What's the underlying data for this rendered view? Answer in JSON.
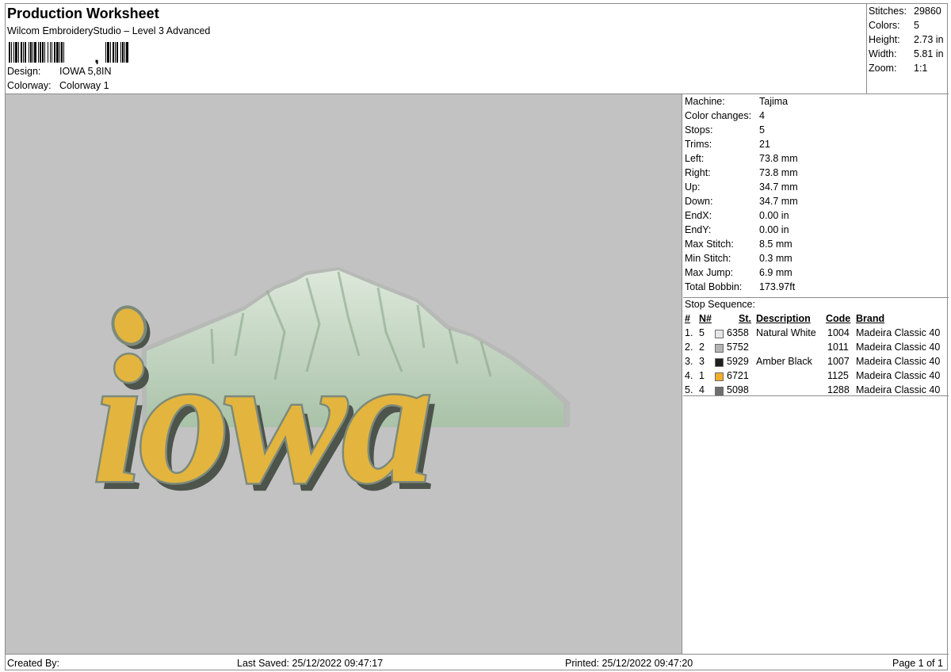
{
  "header": {
    "title": "Production Worksheet",
    "subtitle": "Wilcom EmbroideryStudio – Level 3 Advanced",
    "barcode_suffix": ",",
    "design_label": "Design:",
    "design_value": "IOWA 5,8IN",
    "colorway_label": "Colorway:",
    "colorway_value": "Colorway 1"
  },
  "stats": [
    {
      "label": "Stitches:",
      "value": "29860"
    },
    {
      "label": "Colors:",
      "value": "5"
    },
    {
      "label": "Height:",
      "value": "2.73 in"
    },
    {
      "label": "Width:",
      "value": "5.81 in"
    },
    {
      "label": "Zoom:",
      "value": "1:1"
    }
  ],
  "info": [
    {
      "label": "Machine:",
      "value": "Tajima"
    },
    {
      "label": "Color changes:",
      "value": "4"
    },
    {
      "label": "Stops:",
      "value": "5"
    },
    {
      "label": "Trims:",
      "value": "21"
    },
    {
      "label": "Left:",
      "value": "73.8 mm"
    },
    {
      "label": "Right:",
      "value": "73.8 mm"
    },
    {
      "label": "Up:",
      "value": "34.7 mm"
    },
    {
      "label": "Down:",
      "value": "34.7 mm"
    },
    {
      "label": "EndX:",
      "value": "0.00 in"
    },
    {
      "label": "EndY:",
      "value": "0.00 in"
    },
    {
      "label": "Max Stitch:",
      "value": "8.5 mm"
    },
    {
      "label": "Min Stitch:",
      "value": "0.3 mm"
    },
    {
      "label": "Max Jump:",
      "value": "6.9 mm"
    },
    {
      "label": "Total Bobbin:",
      "value": "173.97ft"
    }
  ],
  "stop_sequence": {
    "label": "Stop Sequence:",
    "headers": {
      "num": "#",
      "n": "N#",
      "st": "St.",
      "description": "Description",
      "code": "Code",
      "brand": "Brand"
    },
    "rows": [
      {
        "num": "1.",
        "n": "5",
        "swatch": "#e6e6ea",
        "st": "6358",
        "description": "Natural White",
        "code": "1004",
        "brand": "Madeira Classic 40"
      },
      {
        "num": "2.",
        "n": "2",
        "swatch": "#b4b4b4",
        "st": "5752",
        "description": "",
        "code": "1011",
        "brand": "Madeira Classic 40"
      },
      {
        "num": "3.",
        "n": "3",
        "swatch": "#1e1e1e",
        "st": "5929",
        "description": "Amber Black",
        "code": "1007",
        "brand": "Madeira Classic 40"
      },
      {
        "num": "4.",
        "n": "1",
        "swatch": "#f0ae2a",
        "st": "6721",
        "description": "",
        "code": "1125",
        "brand": "Madeira Classic 40"
      },
      {
        "num": "5.",
        "n": "4",
        "swatch": "#6e6e6e",
        "st": "5098",
        "description": "",
        "code": "1288",
        "brand": "Madeira Classic 40"
      }
    ]
  },
  "artwork": {
    "text": "iowa",
    "colors": {
      "background": "#c2c2c2",
      "letter_fill": "#e3b53e",
      "letter_outline": "#7d8a7b",
      "shadow": "#4d544c",
      "mountain": "#bcd1bb",
      "mountain_dark": "#8aa68a"
    }
  },
  "footer": {
    "created_by": "Created By:",
    "last_saved": "Last Saved: 25/12/2022 09:47:17",
    "printed": "Printed: 25/12/2022 09:47:20",
    "page": "Page 1 of 1"
  }
}
